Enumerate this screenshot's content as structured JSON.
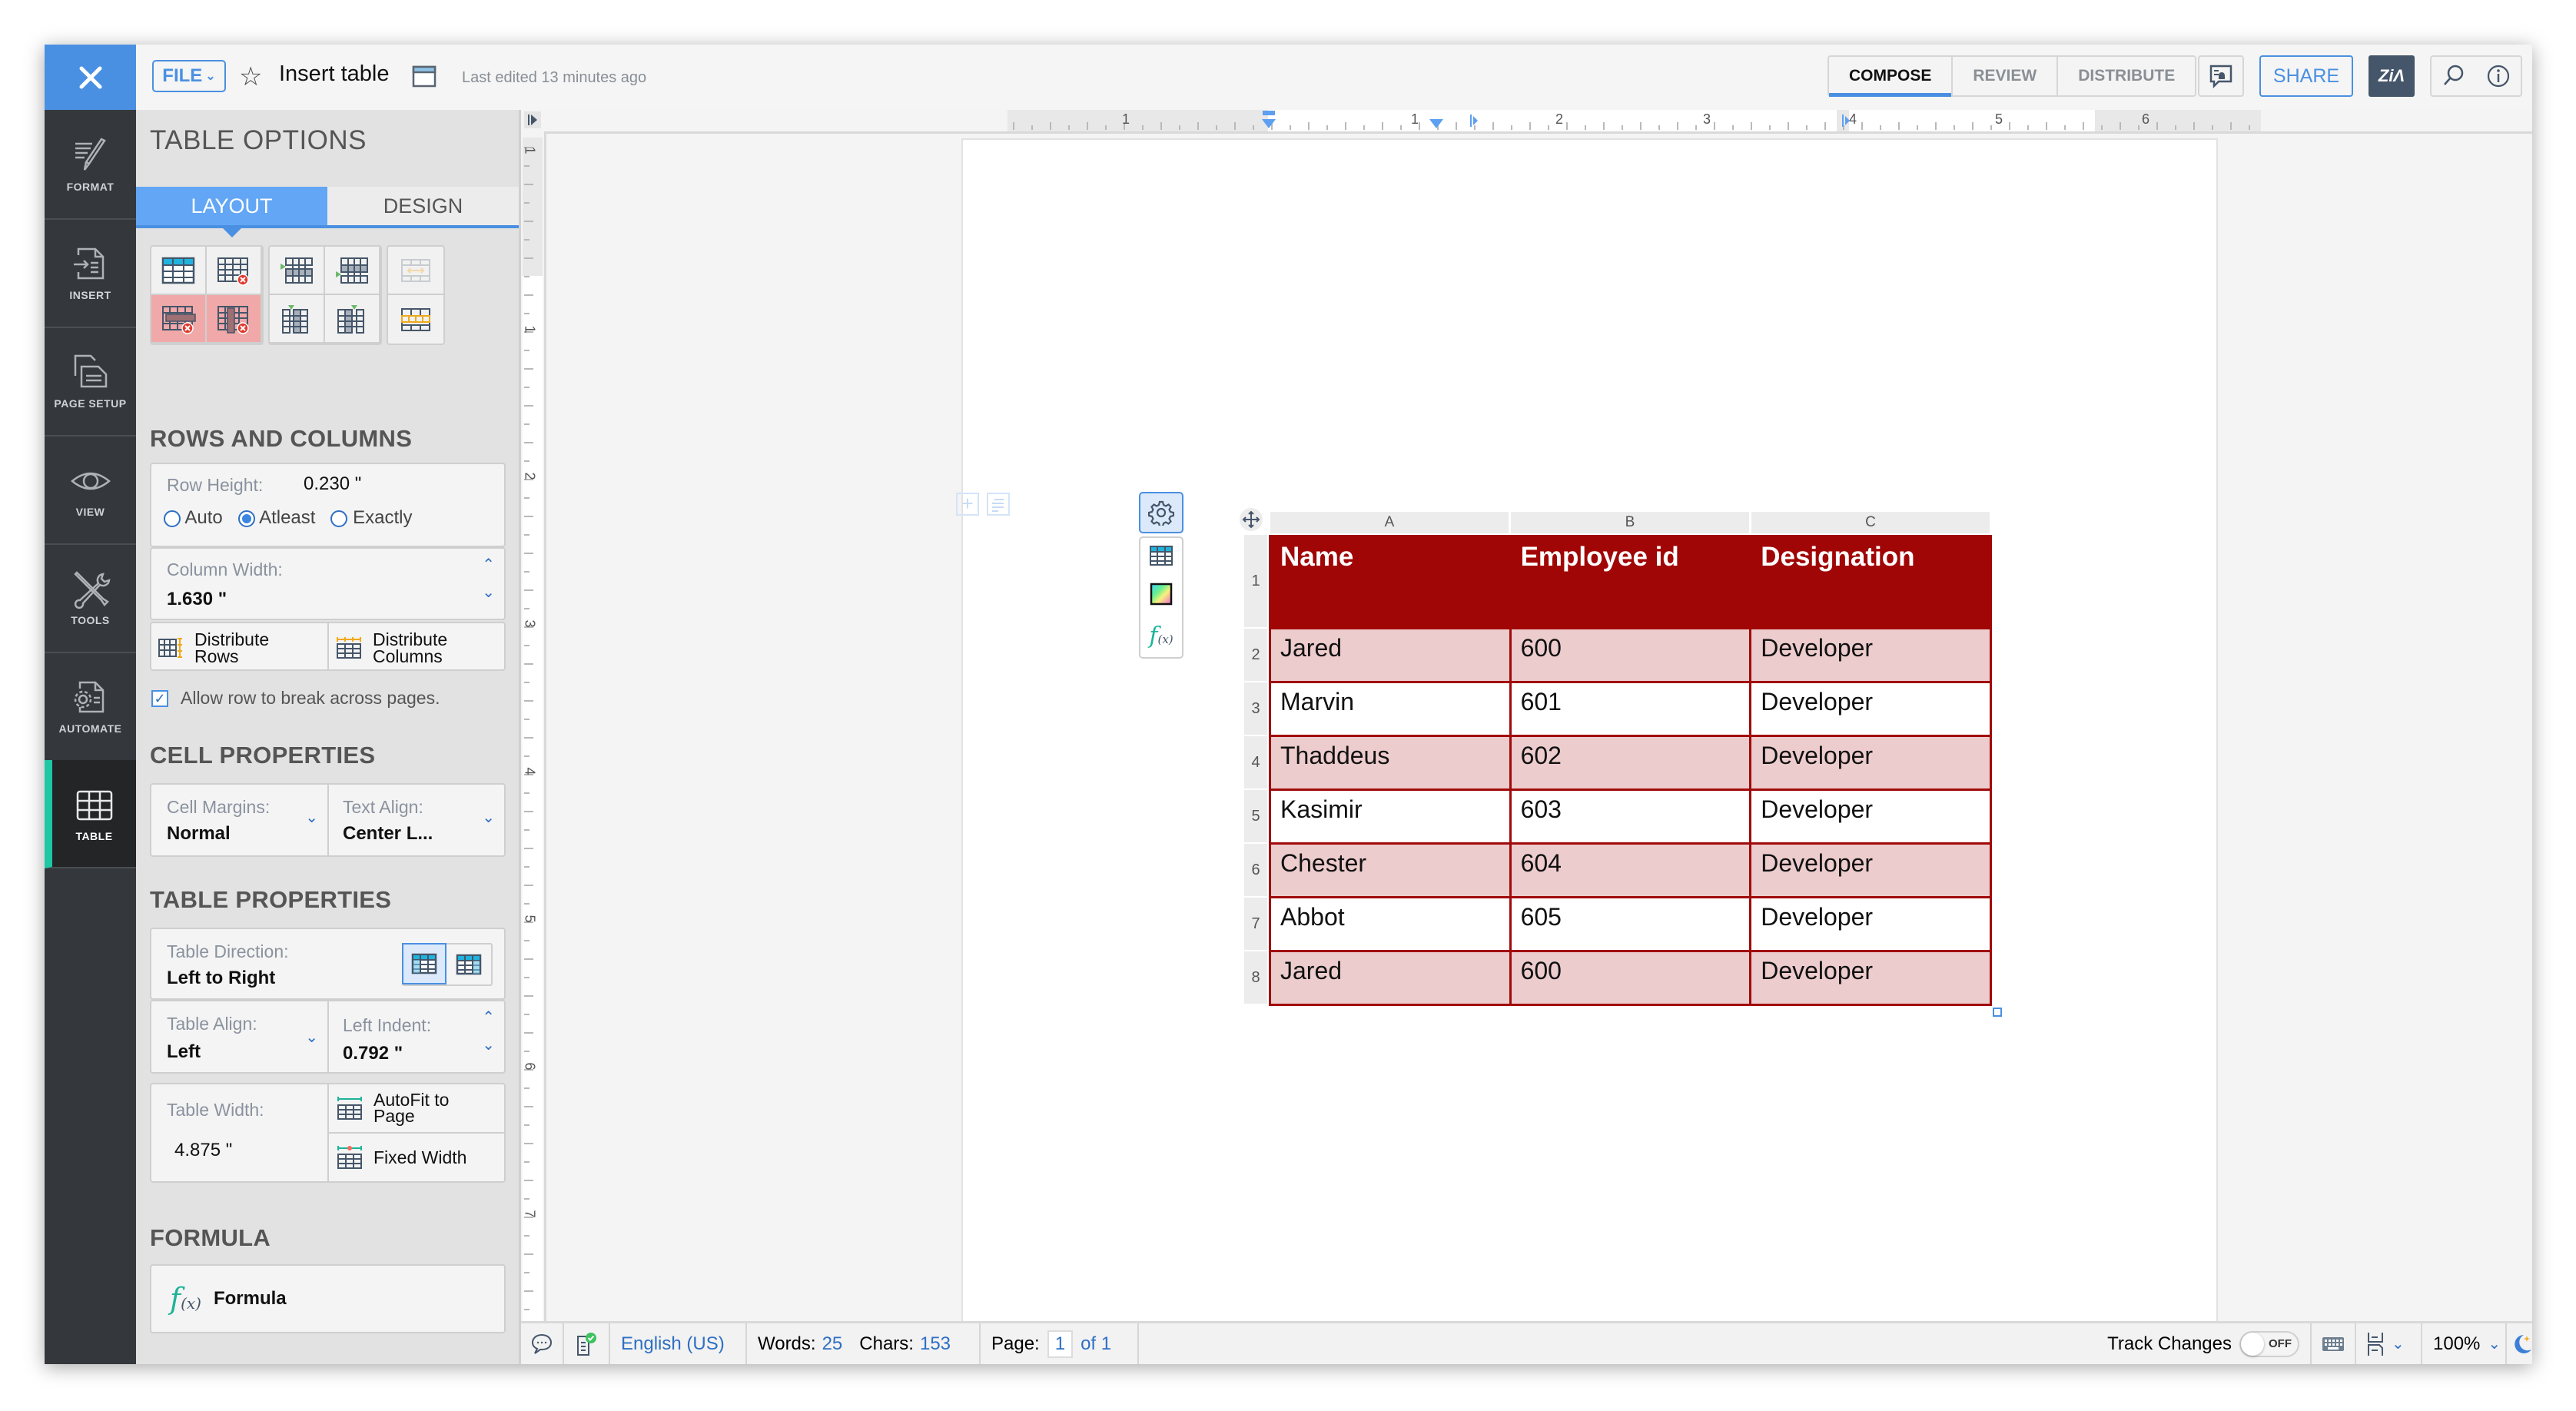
{
  "topbar": {
    "file_label": "FILE",
    "doc_title": "Insert table",
    "last_edited": "Last edited 13 minutes ago",
    "mode_tabs": [
      {
        "label": "COMPOSE",
        "active": true
      },
      {
        "label": "REVIEW",
        "active": false
      },
      {
        "label": "DISTRIBUTE",
        "active": false
      }
    ],
    "share_label": "SHARE",
    "zia_label": "Zia"
  },
  "rail": {
    "items": [
      {
        "label": "FORMAT",
        "icon": "brush-icon"
      },
      {
        "label": "INSERT",
        "icon": "insert-icon"
      },
      {
        "label": "PAGE SETUP",
        "icon": "page-setup-icon"
      },
      {
        "label": "VIEW",
        "icon": "eye-icon"
      },
      {
        "label": "TOOLS",
        "icon": "tools-icon"
      },
      {
        "label": "AUTOMATE",
        "icon": "automate-icon"
      },
      {
        "label": "TABLE",
        "icon": "table-icon",
        "active": true
      }
    ]
  },
  "panel": {
    "title": "TABLE OPTIONS",
    "tabs": [
      {
        "label": "LAYOUT",
        "active": true
      },
      {
        "label": "DESIGN",
        "active": false
      }
    ],
    "rows_columns": {
      "heading": "ROWS AND COLUMNS",
      "row_height_label": "Row Height:",
      "row_height_value": "0.230 \"",
      "radio_options": [
        {
          "label": "Auto",
          "selected": false
        },
        {
          "label": "Atleast",
          "selected": true
        },
        {
          "label": "Exactly",
          "selected": false
        }
      ],
      "column_width_label": "Column Width:",
      "column_width_value": "1.630 \"",
      "distribute_rows_l1": "Distribute",
      "distribute_rows_l2": "Rows",
      "distribute_cols_l1": "Distribute",
      "distribute_cols_l2": "Columns",
      "allow_break_label": "Allow row to break across pages.",
      "allow_break_checked": true
    },
    "cell_properties": {
      "heading": "CELL PROPERTIES",
      "cell_margins_label": "Cell Margins:",
      "cell_margins_value": "Normal",
      "text_align_label": "Text Align:",
      "text_align_value": "Center L..."
    },
    "table_properties": {
      "heading": "TABLE PROPERTIES",
      "direction_label": "Table Direction:",
      "direction_value": "Left to Right",
      "align_label": "Table Align:",
      "align_value": "Left",
      "indent_label": "Left Indent:",
      "indent_value": "0.792 \"",
      "width_label": "Table Width:",
      "width_value": "4.875 \"",
      "autofit_l1": "AutoFit to",
      "autofit_l2": "Page",
      "fixed_width": "Fixed Width"
    },
    "formula": {
      "heading": "FORMULA",
      "button_label": "Formula"
    }
  },
  "ruler": {
    "h_labels": [
      "1",
      "1",
      "2",
      "3",
      "4",
      "5",
      "6"
    ],
    "v_labels": [
      "1",
      "1",
      "2",
      "3",
      "4",
      "5",
      "6",
      "7"
    ]
  },
  "document": {
    "column_letters": [
      "A",
      "B",
      "C"
    ],
    "row_numbers": [
      "1",
      "2",
      "3",
      "4",
      "5",
      "6",
      "7",
      "8"
    ],
    "header": [
      "Name",
      "Employee id",
      "Designation"
    ],
    "rows": [
      [
        "Jared",
        "600",
        "Developer"
      ],
      [
        "Marvin",
        "601",
        "Developer"
      ],
      [
        "Thaddeus",
        "602",
        "Developer"
      ],
      [
        "Kasimir",
        "603",
        "Developer"
      ],
      [
        "Chester",
        "604",
        "Developer"
      ],
      [
        "Abbot",
        "605",
        "Developer"
      ],
      [
        "Jared",
        "600",
        "Developer"
      ]
    ],
    "header_color": "#a10606",
    "alt_row_color": "#edcccd"
  },
  "statusbar": {
    "language": "English (US)",
    "words_label": "Words:",
    "words_value": "25",
    "chars_label": "Chars:",
    "chars_value": "153",
    "page_label": "Page:",
    "page_value": "1",
    "page_total": "of 1",
    "track_changes_label": "Track Changes",
    "track_changes_state": "OFF",
    "zoom": "100%"
  }
}
